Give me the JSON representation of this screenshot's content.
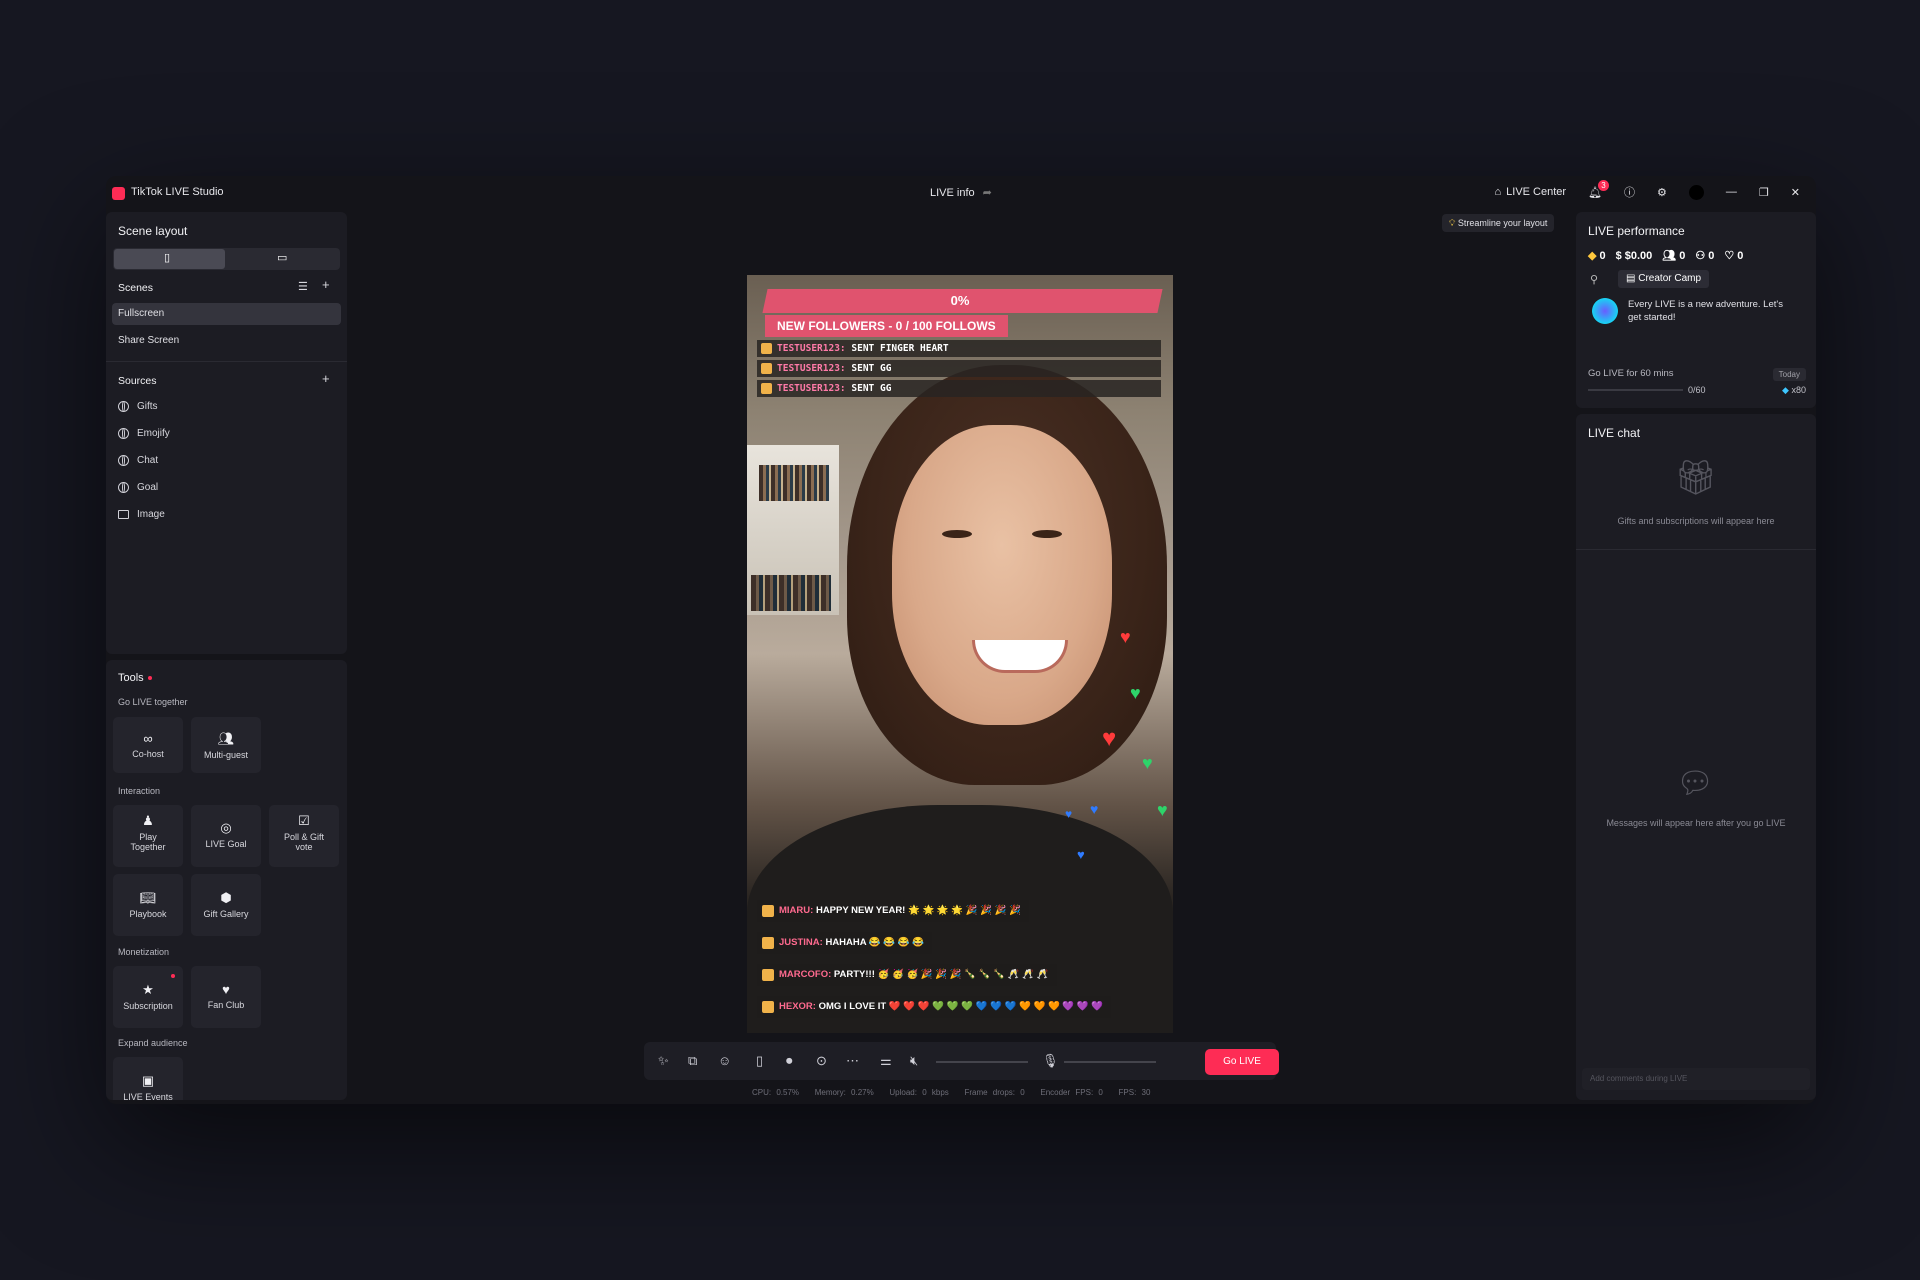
{
  "app": {
    "title": "TikTok LIVE Studio",
    "center_title": "LIVE info",
    "live_center": "LIVE Center",
    "notif_count": "3"
  },
  "scene_layout": {
    "title": "Scene layout"
  },
  "scenes": {
    "title": "Scenes",
    "items": [
      "Fullscreen",
      "Share Screen"
    ]
  },
  "sources": {
    "title": "Sources",
    "items": [
      "Gifts",
      "Emojify",
      "Chat",
      "Goal",
      "Image"
    ]
  },
  "tools": {
    "title": "Tools",
    "sections": {
      "together": "Go LIVE together",
      "interaction": "Interaction",
      "monetization": "Monetization",
      "expand": "Expand audience"
    },
    "items": {
      "cohost": "Co-host",
      "multiguest": "Multi-guest",
      "play": "Play Together",
      "livegoal": "LIVE Goal",
      "poll": "Poll & Gift vote",
      "playbook": "Playbook",
      "giftgallery": "Gift Gallery",
      "subscription": "Subscription",
      "fanclub": "Fan Club",
      "events": "LIVE Events"
    }
  },
  "hint": "Streamline your layout",
  "preview": {
    "goal_pct": "0%",
    "goal_label": "NEW FOLLOWERS - 0 / 100 FOLLOWS",
    "alerts": [
      {
        "user": "TESTUSER123:",
        "text": "SENT FINGER HEART"
      },
      {
        "user": "TESTUSER123:",
        "text": "SENT GG"
      },
      {
        "user": "TESTUSER123:",
        "text": "SENT GG"
      }
    ],
    "chat": [
      {
        "user": "MIARU:",
        "text": "HAPPY NEW YEAR! 🌟 🌟 🌟 🌟 🎉 🎉 🎉 🎉"
      },
      {
        "user": "JUSTINA:",
        "text": "HAHAHA 😂 😂 😂 😂"
      },
      {
        "user": "MARCOFO:",
        "text": "PARTY!!! 🥳 🥳 🥳 🎉 🎉 🎉 🍾 🍾 🍾 🥂 🥂 🥂"
      },
      {
        "user": "HEXOR:",
        "text": "OMG I LOVE IT ❤️ ❤️ ❤️ 💚 💚 💚 💙 💙 💙 🧡 🧡 🧡 💜 💜 💜"
      }
    ]
  },
  "controls": {
    "golive": "Go LIVE"
  },
  "status": {
    "cpu": "CPU: 0.57%",
    "memory": "Memory: 0.27%",
    "upload": "Upload: 0 kbps",
    "drops": "Frame drops: 0",
    "encoder": "Encoder FPS: 0",
    "fps": "FPS: 30"
  },
  "performance": {
    "title": "LIVE performance",
    "diamonds": "0",
    "money": "$0.00",
    "viewers": "0",
    "new_followers": "0",
    "likes": "0",
    "creator_camp": "Creator Camp",
    "adventure": "Every LIVE is a new adventure. Let's get started!",
    "task": "Go LIVE for 60 mins",
    "today": "Today",
    "progress": "0/60",
    "progress_value": 0,
    "reward": "x80"
  },
  "chat": {
    "title": "LIVE chat",
    "gifts_placeholder": "Gifts and subscriptions will appear here",
    "messages_placeholder": "Messages will appear here after you go LIVE",
    "input_placeholder": "Add comments during LIVE"
  },
  "colors": {
    "accent": "#fe2c55",
    "panel": "#1c1c23",
    "goal": "#e0536e"
  }
}
